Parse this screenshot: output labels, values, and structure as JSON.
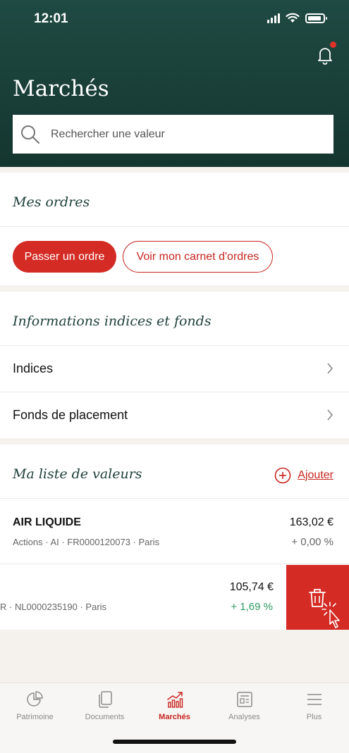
{
  "status_bar": {
    "time": "12:01"
  },
  "header": {
    "title": "Marchés"
  },
  "search": {
    "placeholder": "Rechercher une valeur"
  },
  "orders": {
    "title": "Mes ordres",
    "primary_button": "Passer un ordre",
    "secondary_button": "Voir mon carnet d'ordres"
  },
  "info": {
    "title": "Informations indices et fonds",
    "items": [
      {
        "label": "Indices"
      },
      {
        "label": "Fonds de placement"
      }
    ]
  },
  "watchlist": {
    "title": "Ma liste de valeurs",
    "add_label": "Ajouter",
    "stocks": [
      {
        "name": "AIR LIQUIDE",
        "meta": "Actions · AI · FR0000120073 · Paris",
        "price": "163,02 €",
        "variation": "+ 0,00 %",
        "variation_color": "#666666"
      },
      {
        "name": "",
        "meta": "R · NL0000235190 · Paris",
        "price": "105,74 €",
        "variation": "+ 1,69 %",
        "variation_color": "#2e9a63"
      }
    ],
    "delete_icon": "trash-icon"
  },
  "tabbar": {
    "tabs": [
      {
        "label": "Patrimoine",
        "icon": "pie-chart-icon",
        "active": false
      },
      {
        "label": "Documents",
        "icon": "documents-icon",
        "active": false
      },
      {
        "label": "Marchés",
        "icon": "market-chart-icon",
        "active": true
      },
      {
        "label": "Analyses",
        "icon": "newspaper-icon",
        "active": false
      },
      {
        "label": "Plus",
        "icon": "menu-icon",
        "active": false
      }
    ]
  },
  "colors": {
    "header_bg": "#1f4a43",
    "accent": "#d42b25",
    "positive": "#2e9a63"
  }
}
